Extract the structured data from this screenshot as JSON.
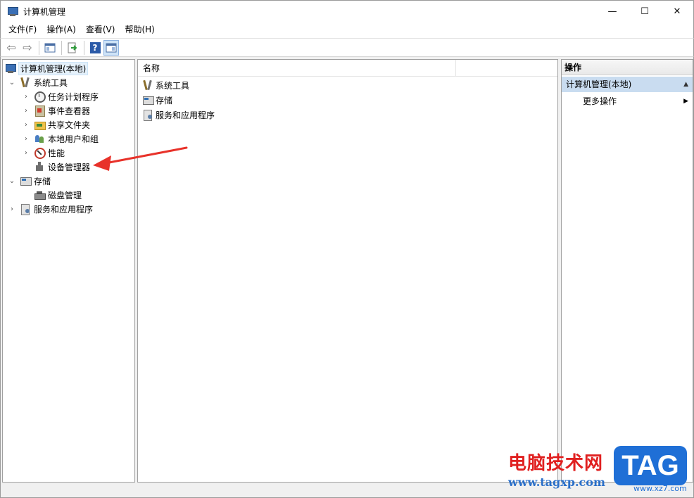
{
  "window": {
    "title": "计算机管理",
    "minimize_glyph": "—",
    "maximize_glyph": "☐",
    "close_glyph": "✕"
  },
  "menu": [
    {
      "label": "文件(F)"
    },
    {
      "label": "操作(A)"
    },
    {
      "label": "查看(V)"
    },
    {
      "label": "帮助(H)"
    }
  ],
  "toolbar": {
    "back_glyph": "⇦",
    "forward_glyph": "⇨",
    "help_glyph": "?"
  },
  "tree": {
    "root": "计算机管理(本地)",
    "items": [
      {
        "label": "系统工具",
        "icon": "tools-icon",
        "expander": "⌄"
      },
      {
        "label": "任务计划程序",
        "icon": "clock-icon",
        "expander": "›"
      },
      {
        "label": "事件查看器",
        "icon": "event-viewer-icon",
        "expander": "›"
      },
      {
        "label": "共享文件夹",
        "icon": "shared-folder-icon",
        "expander": "›"
      },
      {
        "label": "本地用户和组",
        "icon": "users-icon",
        "expander": "›"
      },
      {
        "label": "性能",
        "icon": "performance-icon",
        "expander": "›"
      },
      {
        "label": "设备管理器",
        "icon": "device-manager-icon",
        "expander": ""
      },
      {
        "label": "存储",
        "icon": "storage-icon",
        "expander": "⌄"
      },
      {
        "label": "磁盘管理",
        "icon": "disk-icon",
        "expander": ""
      },
      {
        "label": "服务和应用程序",
        "icon": "services-icon",
        "expander": "›"
      }
    ]
  },
  "list": {
    "column_name": "名称",
    "rows": [
      {
        "label": "系统工具",
        "icon": "tools-icon"
      },
      {
        "label": "存储",
        "icon": "storage-icon"
      },
      {
        "label": "服务和应用程序",
        "icon": "services-icon"
      }
    ]
  },
  "actions": {
    "header": "操作",
    "section": "计算机管理(本地)",
    "section_glyph": "▲",
    "more": "更多操作",
    "more_glyph": "▶"
  },
  "annotation": {
    "arrow_color": "#e8322a"
  },
  "watermark": {
    "site_name": "电脑技术网",
    "url": "www.tagxp.com",
    "badge": "TAG",
    "sub": "www.xz7.com"
  }
}
